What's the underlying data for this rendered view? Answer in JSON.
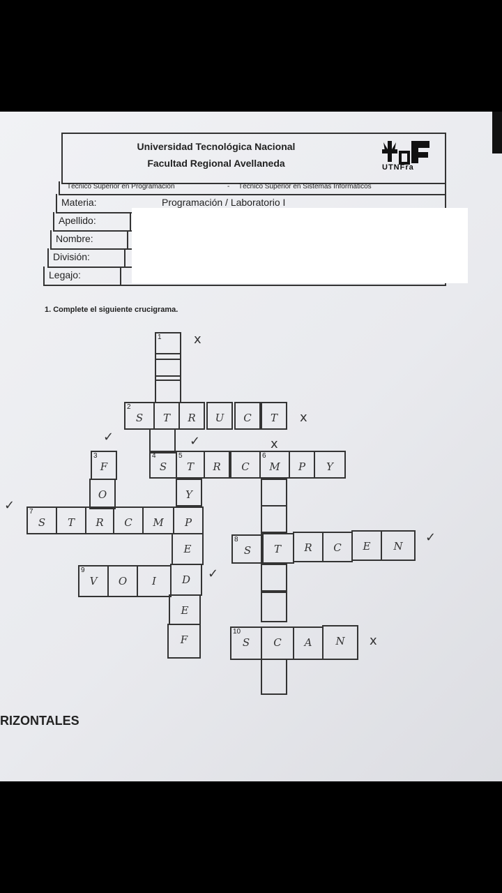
{
  "header": {
    "university": "Universidad Tecnológica Nacional",
    "faculty": "Facultad Regional Avellaneda",
    "logo_text": "UTNFra",
    "career_1": "Técnico Superior en Programación",
    "separator": "-",
    "career_2": "Técnico Superior en Sistemas Informáticos"
  },
  "form": {
    "materia_label": "Materia:",
    "materia_value": "Programación / Laboratorio I",
    "apellido_label": "Apellido:",
    "nombre_label": "Nombre:",
    "division_label": "División:",
    "legajo_label": "Legajo:"
  },
  "question": "1. Complete el siguiente crucigrama.",
  "section_label": "RIZONTALES",
  "grid": {
    "numbers": {
      "n1": "1",
      "n2": "2",
      "n3": "3",
      "n4": "4",
      "n5": "5",
      "n6": "6",
      "n7": "7",
      "n8": "8",
      "n9": "9",
      "n10": "10"
    },
    "letters": {
      "r2": [
        "S",
        "T",
        "R",
        "U",
        "C",
        "T"
      ],
      "r4": [
        "S",
        "T",
        "R",
        "C",
        "M",
        "P",
        "Y"
      ],
      "c3": [
        "F",
        "O"
      ],
      "r7": [
        "S",
        "T",
        "R",
        "C",
        "M",
        "P"
      ],
      "c5": [
        "Y",
        "P",
        "E",
        "D",
        "E",
        "F"
      ],
      "r8": [
        "S",
        "T",
        "R",
        "C",
        "E",
        "N"
      ],
      "r9": [
        "V",
        "O",
        "I",
        "D"
      ],
      "r10": [
        "S",
        "C",
        "A",
        "N"
      ]
    }
  },
  "marks": {
    "cross": "x",
    "check": "✓"
  }
}
